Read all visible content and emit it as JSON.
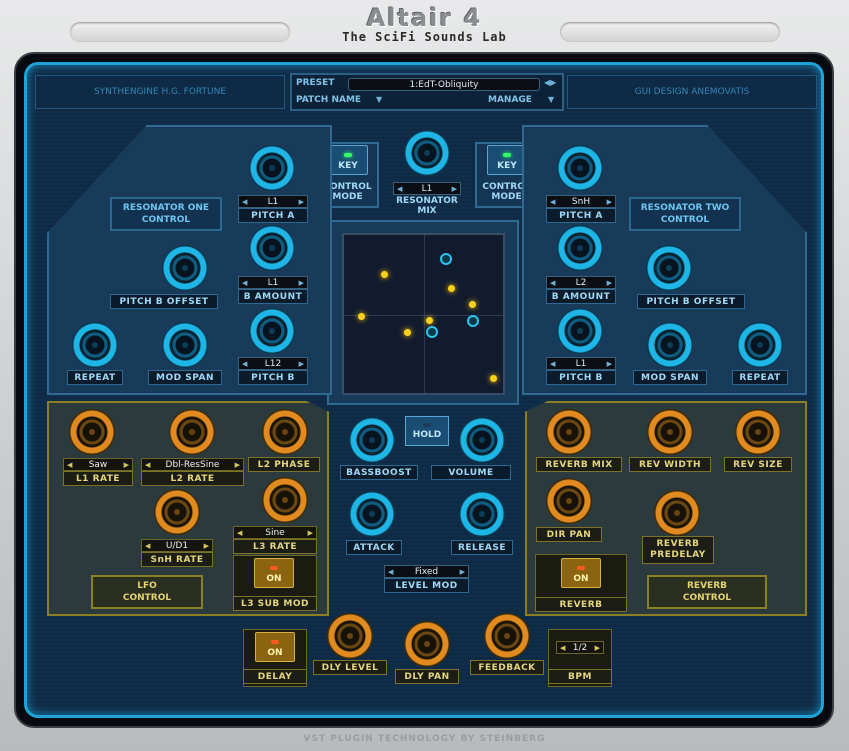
{
  "app": {
    "title": "Altair 4",
    "subtitle": "The SciFi Sounds Lab",
    "footer": "VST PLUGIN TECHNOLOGY BY STEINBERG"
  },
  "header": {
    "synth_credit": "SYNTHENGINE H.G. FORTUNE",
    "gui_credit": "GUI DESIGN ANEMOVATIS",
    "preset_label": "PRESET",
    "preset_value": "1:EdT-Obliquity",
    "patch_name_label": "PATCH NAME",
    "manage_label": "MANAGE"
  },
  "center": {
    "control_mode_left": "CONTROL\nMODE",
    "control_mode_right": "CONTROL\nMODE",
    "key_label": "KEY",
    "resonator_mix_sel": "L1",
    "resonator_mix_label": "RESONATOR\nMIX",
    "hold_label": "HOLD",
    "bassboost": "BASSBOOST",
    "volume": "VOLUME",
    "attack": "ATTACK",
    "release": "RELEASE",
    "level_mod_sel": "Fixed",
    "level_mod": "LEVEL MOD"
  },
  "res1": {
    "title": "RESONATOR ONE\nCONTROL",
    "pitch_a_sel": "L1",
    "pitch_a": "PITCH A",
    "b_amount_sel": "L1",
    "b_amount": "B AMOUNT",
    "pitch_b_sel": "L12",
    "pitch_b": "PITCH B",
    "pitch_b_offset": "PITCH B OFFSET",
    "repeat": "REPEAT",
    "mod_span": "MOD SPAN"
  },
  "res2": {
    "title": "RESONATOR TWO\nCONTROL",
    "pitch_a_sel": "SnH",
    "pitch_a": "PITCH A",
    "b_amount_sel": "L2",
    "b_amount": "B AMOUNT",
    "pitch_b_sel": "L1",
    "pitch_b": "PITCH B",
    "pitch_b_offset": "PITCH B OFFSET",
    "repeat": "REPEAT",
    "mod_span": "MOD SPAN"
  },
  "lfo": {
    "title": "LFO\nCONTROL",
    "l1_rate_sel": "Saw",
    "l1_rate": "L1 RATE",
    "l2_rate_sel": "Dbl-ResSine",
    "l2_rate": "L2 RATE",
    "l2_phase": "L2 PHASE",
    "snh_rate_sel": "U/D1",
    "snh_rate": "SnH RATE",
    "l3_rate_sel": "Sine",
    "l3_rate": "L3 RATE",
    "on": "ON",
    "l3_sub_mod": "L3 SUB MOD"
  },
  "reverb": {
    "title": "REVERB\nCONTROL",
    "mix": "REVERB MIX",
    "width": "REV WIDTH",
    "size": "REV SIZE",
    "dir_pan": "DIR PAN",
    "predelay": "REVERB\nPREDELAY",
    "on": "ON",
    "label": "REVERB"
  },
  "delay": {
    "on": "ON",
    "label": "DELAY",
    "level": "DLY LEVEL",
    "pan": "DLY PAN",
    "feedback": "FEEDBACK",
    "bpm_sel": "1/2",
    "bpm": "BPM"
  },
  "colors": {
    "accent": "#1fa3d6",
    "panel": "#102e4a",
    "orange": "#e08a1f",
    "yellow": "#ffd21a"
  }
}
